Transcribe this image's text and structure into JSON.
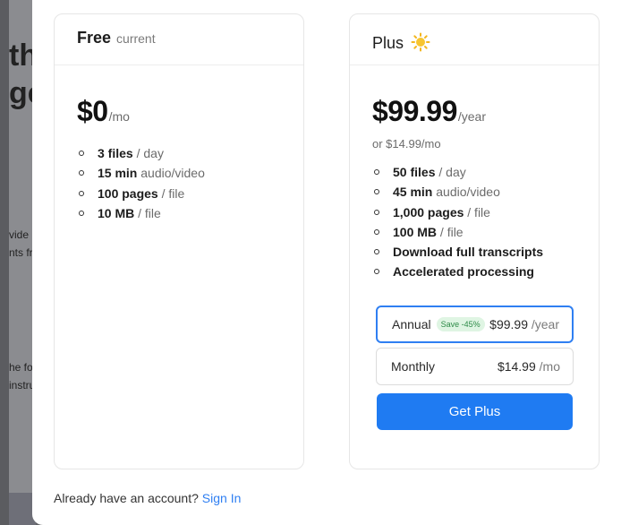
{
  "background": {
    "line1": "th",
    "line2": "ge",
    "line3": "vide",
    "line4": "nts fr",
    "line5": "he fo",
    "line6": "instru"
  },
  "free_plan": {
    "name": "Free",
    "tag": "current",
    "price": "$0",
    "period": "/mo",
    "features": [
      {
        "strong": "3 files",
        "rest": " / day"
      },
      {
        "strong": "15 min",
        "rest": " audio/video"
      },
      {
        "strong": "100 pages",
        "rest": " / file"
      },
      {
        "strong": "10 MB",
        "rest": " / file"
      }
    ]
  },
  "plus_plan": {
    "name": "Plus",
    "icon": "sun-icon",
    "price": "$99.99",
    "period": "/year",
    "alt_price": "or $14.99/mo",
    "features": [
      {
        "strong": "50 files",
        "rest": " / day"
      },
      {
        "strong": "45 min",
        "rest": " audio/video"
      },
      {
        "strong": "1,000 pages",
        "rest": " / file"
      },
      {
        "strong": "100 MB",
        "rest": " / file"
      },
      {
        "strong": "Download full transcripts",
        "rest": ""
      },
      {
        "strong": "Accelerated processing",
        "rest": ""
      }
    ],
    "billing_options": {
      "annual": {
        "label": "Annual",
        "badge": "Save -45%",
        "price": "$99.99",
        "unit": "/year",
        "selected": true
      },
      "monthly": {
        "label": "Monthly",
        "price": "$14.99",
        "unit": "/mo",
        "selected": false
      }
    },
    "cta_label": "Get Plus"
  },
  "footer": {
    "prompt": "Already have an account?",
    "link_label": "Sign In"
  },
  "colors": {
    "accent": "#1f7bf2",
    "badge_bg": "#dff5e3",
    "badge_text": "#2e8b48"
  }
}
